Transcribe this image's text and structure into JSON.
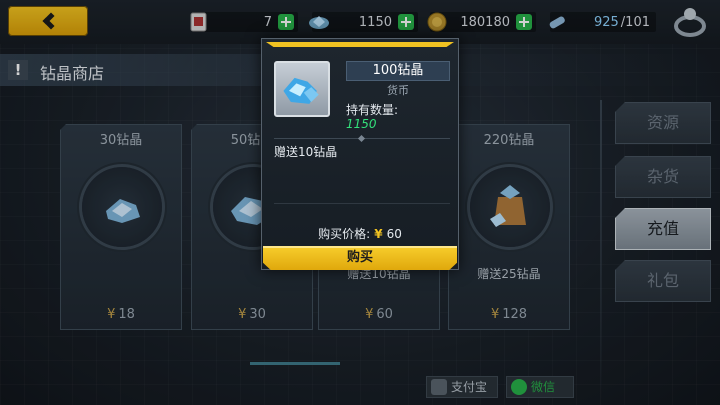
{
  "topbar": {
    "resources": [
      {
        "icon": "card-icon",
        "value": "7"
      },
      {
        "icon": "crystal-icon",
        "value": "1150"
      },
      {
        "icon": "coin-icon",
        "value": "180180"
      },
      {
        "icon": "stamina-icon",
        "value": "925",
        "max": "/101"
      }
    ]
  },
  "section": {
    "title": "钻晶商店"
  },
  "cards": [
    {
      "title": "30钻晶",
      "bonus": "",
      "price_symbol": "¥",
      "price": "18"
    },
    {
      "title": "50钻晶",
      "bonus": "",
      "price_symbol": "¥",
      "price": "30"
    },
    {
      "title": "",
      "bonus": "赠送10钻晶",
      "price_symbol": "¥",
      "price": "60"
    },
    {
      "title": "220钻晶",
      "bonus": "赠送25钻晶",
      "price_symbol": "¥",
      "price": "128"
    }
  ],
  "sidebar": {
    "tabs": [
      {
        "label": "资源",
        "active": false
      },
      {
        "label": "杂货",
        "active": false
      },
      {
        "label": "充值",
        "active": true
      },
      {
        "label": "礼包",
        "active": false
      }
    ]
  },
  "payment": {
    "alipay": "支付宝",
    "wechat": "微信"
  },
  "popup": {
    "item_name": "100钻晶",
    "item_type": "货币",
    "owned_label": "持有数量:",
    "owned_value": "1150",
    "gift_text": "赠送10钻晶",
    "price_label": "购买价格:",
    "price_symbol": "¥",
    "price_value": "60",
    "buy_label": "购买"
  },
  "colors": {
    "accent_yellow": "#f0c222",
    "owned_green": "#33e07a",
    "plus_green": "#28b14a"
  }
}
